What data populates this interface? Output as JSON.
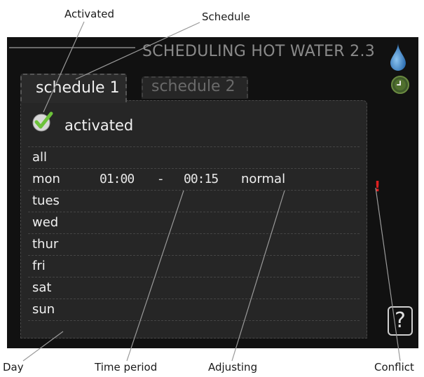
{
  "callouts": {
    "activated": "Activated",
    "schedule": "Schedule",
    "day": "Day",
    "time_period": "Time period",
    "adjusting": "Adjusting",
    "conflict": "Conflict"
  },
  "screen": {
    "header": "SCHEDULING HOT WATER 2.3",
    "icons": [
      "water-drop-icon",
      "clock-icon",
      "check-icon",
      "help-icon"
    ],
    "tabs": [
      {
        "label": "schedule 1",
        "selected": true
      },
      {
        "label": "schedule 2",
        "selected": false
      }
    ],
    "activated_label": "activated",
    "conflict_mark": "!",
    "help_label": "?",
    "rows": [
      {
        "day": "all",
        "start": "",
        "dash": "",
        "end": "",
        "mode": ""
      },
      {
        "day": "mon",
        "start": "01:00",
        "dash": "-",
        "end": "00:15",
        "mode": "normal"
      },
      {
        "day": "tues",
        "start": "",
        "dash": "",
        "end": "",
        "mode": ""
      },
      {
        "day": "wed",
        "start": "",
        "dash": "",
        "end": "",
        "mode": ""
      },
      {
        "day": "thur",
        "start": "",
        "dash": "",
        "end": "",
        "mode": ""
      },
      {
        "day": "fri",
        "start": "",
        "dash": "",
        "end": "",
        "mode": ""
      },
      {
        "day": "sat",
        "start": "",
        "dash": "",
        "end": "",
        "mode": ""
      },
      {
        "day": "sun",
        "start": "",
        "dash": "",
        "end": "",
        "mode": ""
      }
    ],
    "colors": {
      "accent_green": "#6cc23a",
      "water_blue": "#4a90d0",
      "conflict_red": "#e02020"
    }
  }
}
